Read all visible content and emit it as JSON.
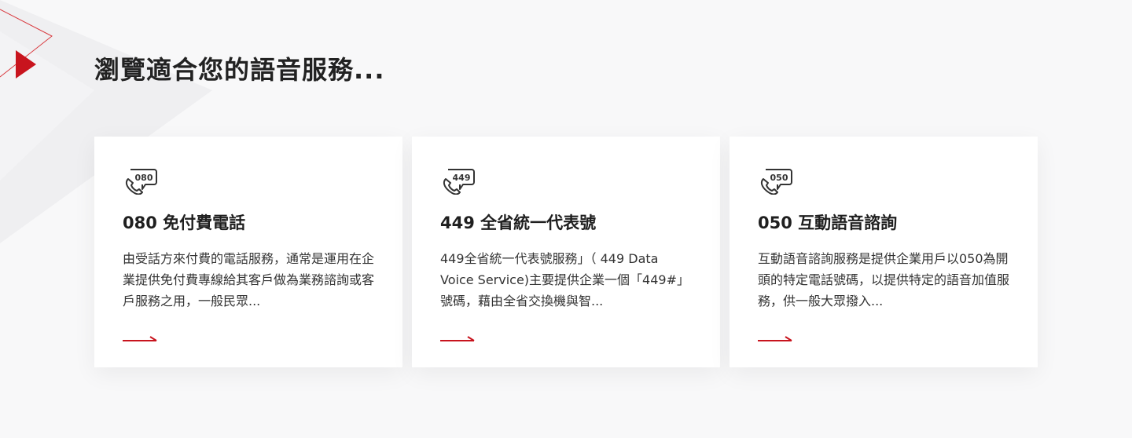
{
  "section": {
    "title": "瀏覽適合您的語音服務..."
  },
  "colors": {
    "accent": "#c8141e",
    "background": "#f8f8f9",
    "card": "#ffffff"
  },
  "cards": [
    {
      "icon": "phone-080-icon",
      "icon_number": "080",
      "title": "080 免付費電話",
      "description": "由受話方來付費的電話服務，通常是運用在企業提供免付費專線給其客戶做為業務諮詢或客戶服務之用，一般民眾..."
    },
    {
      "icon": "phone-449-icon",
      "icon_number": "449",
      "title": "449 全省統一代表號",
      "description": "449全省統一代表號服務」（ 449 Data Voice Service)主要提供企業一個「449#」號碼，藉由全省交換機與智..."
    },
    {
      "icon": "phone-050-icon",
      "icon_number": "050",
      "title": "050 互動語音諮詢",
      "description": "互動語音諮詢服務是提供企業用戶以050為開頭的特定電話號碼，以提供特定的語音加值服務，供一般大眾撥入..."
    }
  ]
}
